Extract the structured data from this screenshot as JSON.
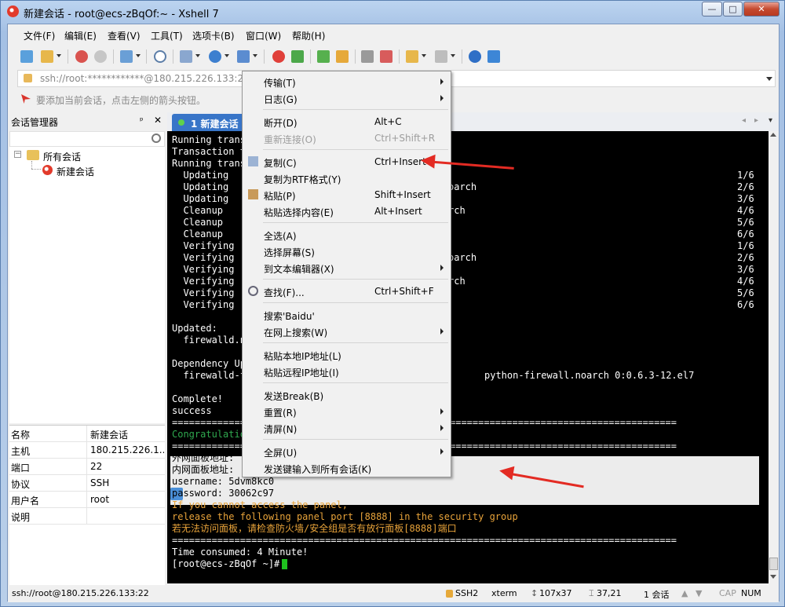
{
  "window": {
    "title": "新建会话 - root@ecs-zBqOf:~ - Xshell 7",
    "controls": {
      "minimize": "—",
      "maximize": "□",
      "close": "✕"
    }
  },
  "menubar": [
    "文件(F)",
    "编辑(E)",
    "查看(V)",
    "工具(T)",
    "选项卡(B)",
    "窗口(W)",
    "帮助(H)"
  ],
  "address": {
    "value": "ssh://root:************@180.215.226.133:22"
  },
  "hint": "要添加当前会话，点击左侧的箭头按钮。",
  "session_manager": {
    "title": "会话管理器",
    "pin": "ᵖ",
    "close": "✕",
    "tree": {
      "root": "所有会话",
      "child": "新建会话"
    },
    "properties": [
      {
        "k": "名称",
        "v": "新建会话"
      },
      {
        "k": "主机",
        "v": "180.215.226.1..."
      },
      {
        "k": "端口",
        "v": "22"
      },
      {
        "k": "协议",
        "v": "SSH"
      },
      {
        "k": "用户名",
        "v": "root"
      },
      {
        "k": "说明",
        "v": ""
      }
    ]
  },
  "tab": {
    "label": "1 新建会话",
    "nav_prev": "◂",
    "nav_next": "▸",
    "dropdown": "▾"
  },
  "terminal": {
    "lines": [
      "Running trans",
      "Transaction t",
      "Running trans",
      "  Updating",
      "  Updating",
      "  Updating",
      "  Cleanup",
      "  Cleanup",
      "  Cleanup",
      "  Verifying",
      "  Verifying",
      "  Verifying",
      "  Verifying",
      "  Verifying",
      "  Verifying",
      "",
      "Updated:",
      "  firewalld.n",
      "",
      "Dependency Up",
      "  firewalld-f",
      "",
      "Complete!",
      "success",
      "=========================================================================================",
      "Congratulatio",
      "=========================================================================================",
      "外网面板地址:",
      "内网面板地址:",
      "username: 5dvm8kc0",
      "password: 30062c97",
      "If you cannot access the panel,",
      "release the following panel port [8888] in the security group",
      "若无法访问面板，请检查防火墙/安全组是否有放行面板[8888]端口",
      "=========================================================================================",
      "Time consumed: 4 Minute!",
      "[root@ecs-zBqOf ~]# "
    ],
    "right_fragments": [
      {
        "row": 4,
        "text": "oarch"
      },
      {
        "row": 6,
        "text": "rch"
      },
      {
        "row": 10,
        "text": "oarch"
      },
      {
        "row": 12,
        "text": "rch"
      },
      {
        "row": 20,
        "text": "python-firewall.noarch 0:0.6.3-12.el7"
      }
    ],
    "counters": [
      "1/6",
      "2/6",
      "3/6",
      "4/6",
      "5/6",
      "6/6",
      "1/6",
      "2/6",
      "3/6",
      "4/6",
      "5/6",
      "6/6"
    ],
    "colors": {
      "background": "#000000",
      "text": "#ffffff",
      "warning": "#e8a33a",
      "green": "#2fa84f",
      "cursor": "#1ec21e"
    }
  },
  "context_menu": {
    "items": [
      {
        "label": "传输(T)",
        "key": "",
        "submenu": true,
        "disabled": false
      },
      {
        "label": "日志(G)",
        "key": "",
        "submenu": true,
        "disabled": false
      },
      {
        "sep": true
      },
      {
        "label": "断开(D)",
        "key": "Alt+C",
        "submenu": false,
        "disabled": false
      },
      {
        "label": "重新连接(O)",
        "key": "Ctrl+Shift+R",
        "submenu": false,
        "disabled": true
      },
      {
        "sep": true
      },
      {
        "label": "复制(C)",
        "key": "Ctrl+Insert",
        "submenu": false,
        "disabled": false,
        "icon": "copy-icon"
      },
      {
        "label": "复制为RTF格式(Y)",
        "key": "",
        "submenu": false,
        "disabled": false
      },
      {
        "label": "粘贴(P)",
        "key": "Shift+Insert",
        "submenu": false,
        "disabled": false,
        "icon": "paste-icon"
      },
      {
        "label": "粘贴选择内容(E)",
        "key": "Alt+Insert",
        "submenu": false,
        "disabled": false
      },
      {
        "sep": true
      },
      {
        "label": "全选(A)",
        "key": "",
        "submenu": false,
        "disabled": false
      },
      {
        "label": "选择屏幕(S)",
        "key": "",
        "submenu": false,
        "disabled": false
      },
      {
        "label": "到文本编辑器(X)",
        "key": "",
        "submenu": true,
        "disabled": false
      },
      {
        "sep": true
      },
      {
        "label": "查找(F)...",
        "key": "Ctrl+Shift+F",
        "submenu": false,
        "disabled": false,
        "icon": "search-icon"
      },
      {
        "sep": true
      },
      {
        "label": "搜索'Baidu'",
        "key": "",
        "submenu": false,
        "disabled": false
      },
      {
        "label": "在网上搜索(W)",
        "key": "",
        "submenu": true,
        "disabled": false
      },
      {
        "sep": true
      },
      {
        "label": "粘贴本地IP地址(L)",
        "key": "",
        "submenu": false,
        "disabled": false
      },
      {
        "label": "粘贴远程IP地址(I)",
        "key": "",
        "submenu": false,
        "disabled": false
      },
      {
        "sep": true
      },
      {
        "label": "发送Break(B)",
        "key": "",
        "submenu": false,
        "disabled": false
      },
      {
        "label": "重置(R)",
        "key": "",
        "submenu": true,
        "disabled": false
      },
      {
        "label": "清屏(N)",
        "key": "",
        "submenu": true,
        "disabled": false
      },
      {
        "sep": true
      },
      {
        "label": "全屏(U)",
        "key": "",
        "submenu": true,
        "disabled": false
      },
      {
        "label": "发送键输入到所有会话(K)",
        "key": "",
        "submenu": false,
        "disabled": false
      }
    ]
  },
  "statusbar": {
    "connection": "ssh://root@180.215.226.133:22",
    "protocol": "SSH2",
    "term": "xterm",
    "size": "107x37",
    "cursor": "37,21",
    "sessions": "1 会话",
    "caps": "CAP",
    "num": "NUM"
  },
  "accent_colors": {
    "tab": "#3875c8",
    "annotation_arrow": "#e32b23"
  }
}
